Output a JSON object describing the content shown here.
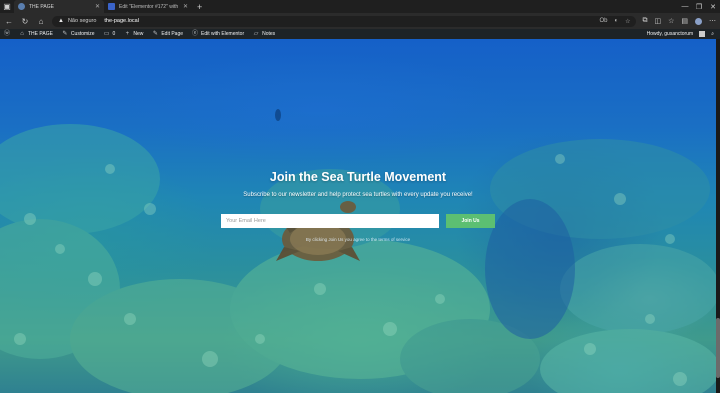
{
  "browser": {
    "tabs": [
      {
        "title": "THE PAGE",
        "active": true
      },
      {
        "title": "Edit \"Elementor #172\" with Elem",
        "active": false
      }
    ],
    "new_tab_symbol": "+",
    "address": {
      "security_label": "Não seguro",
      "url": "the-page.local"
    },
    "zoom_badge": "Ob"
  },
  "adminbar": {
    "items": [
      {
        "label": "THE PAGE",
        "icon": "home-icon"
      },
      {
        "label": "Customize",
        "icon": "brush-icon"
      },
      {
        "label": "0",
        "icon": "comment-icon"
      },
      {
        "label": "New",
        "icon": "plus-icon"
      },
      {
        "label": "Edit Page",
        "icon": "pencil-icon"
      },
      {
        "label": "Edit with Elementor",
        "icon": "elementor-icon"
      },
      {
        "label": "Notes",
        "icon": "notes-icon"
      }
    ],
    "greeting": "Howdy, gusanctorum"
  },
  "hero": {
    "title": "Join the Sea Turtle Movement",
    "subtitle": "Subscribe to our newsletter and help protect sea turtles with every update you receive!",
    "email_placeholder": "Your Email Here",
    "button_label": "Join Us",
    "privacy_note": "By clicking Join Us you agree to the terms of service"
  },
  "colors": {
    "button_green": "#5cbf72",
    "adminbar_bg": "#1d2327",
    "browser_bg": "#1f1f1f"
  }
}
